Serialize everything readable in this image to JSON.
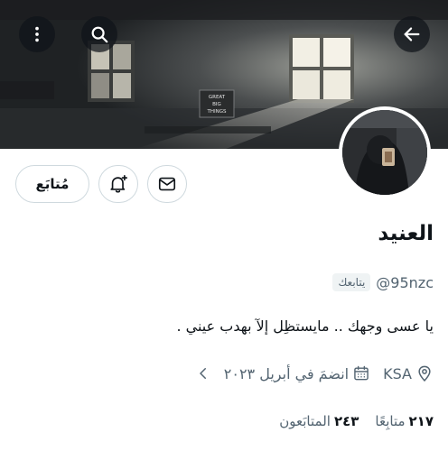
{
  "profile": {
    "display_name": "العنيد",
    "handle": "@95nzc",
    "follows_you_label": "يتابعك",
    "bio": "يا عسى وجهك .. مايستظِل إلآ بهدب عيني .",
    "location": "KSA",
    "joined": "انضمَ في أبريل ٢٠٢٣",
    "followers_count": "٢٤٣",
    "followers_label": "المتابَعون",
    "following_count": "٢١٧",
    "following_label": "متابِعًا"
  },
  "banner": {
    "sign_text": [
      "GREAT",
      "BIG",
      "THINGS"
    ]
  },
  "actions": {
    "follow_label": "مُتابَع"
  },
  "icons": {
    "back": "arrow-left-icon",
    "search": "search-icon",
    "more": "more-vertical-icon",
    "bell": "bell-plus-icon",
    "mail": "mail-icon",
    "location": "location-pin-icon",
    "calendar": "calendar-icon",
    "chevron": "chevron-left-icon"
  },
  "colors": {
    "text_primary": "#0f1419",
    "text_secondary": "#536471",
    "border": "#cfd9de",
    "badge_bg": "#eff3f4"
  }
}
